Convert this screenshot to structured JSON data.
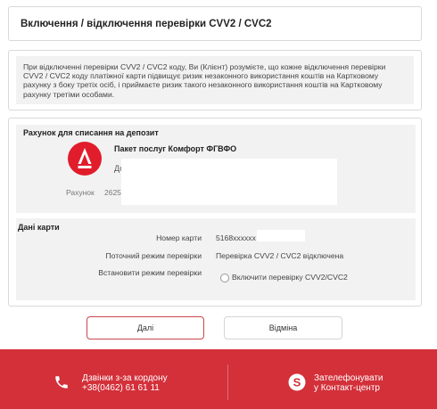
{
  "header": {
    "title": "Включення / відключення перевірки CVV2 / CVC2"
  },
  "warning": {
    "text": "При відключенні перевірки CVV2 / CVC2 коду, Ви (Клієнт) розумієте, що кожне відключення перевірки CVV2 / CVC2 коду платіжної карти підвищує ризик незаконного використання коштів на Картковому рахунку з боку третіх осіб, і приймаєте ризик такого незаконного використання коштів на Картковому рахунку третіми особами."
  },
  "account_section": {
    "title": "Рахунок для списання на депозит",
    "package_name": "Пакет послуг Комфорт ФГВФО",
    "package_sub": "До",
    "account_label": "Рахунок",
    "account_number": "2625"
  },
  "card_section": {
    "title": "Дані карти",
    "rows": [
      {
        "label": "Номер карти",
        "value": "5168xxxxxx"
      },
      {
        "label": "Поточний режим перевірки",
        "value": "Перевірка CVV2 / CVC2 відключена"
      },
      {
        "label": "Встановити режим перевірки",
        "value": ""
      }
    ],
    "radio_option": "Включити перевірку CVV2/CVC2"
  },
  "buttons": {
    "next": "Далі",
    "cancel": "Відміна"
  },
  "footer": {
    "call_abroad_line1": "Дзвінки з-за кордону",
    "call_abroad_line2": "+38(0462) 61 61 11",
    "skype_line1": "Зателефонувати",
    "skype_line2": "у Контакт-центр",
    "icons": [
      "phone-icon",
      "skype-icon"
    ]
  },
  "colors": {
    "brand_red": "#d3303a",
    "logo_red": "#e11d2c",
    "panel_gray": "#f2f2f2"
  }
}
